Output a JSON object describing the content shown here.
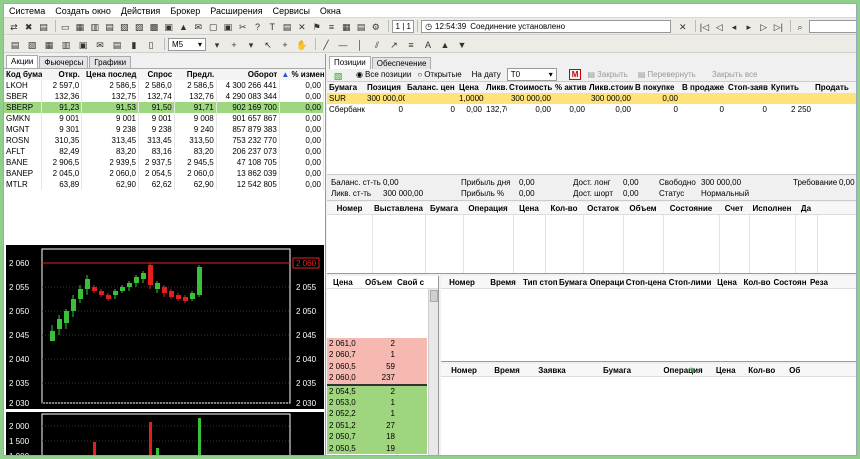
{
  "menu": [
    "Система",
    "Создать окно",
    "Действия",
    "Брокер",
    "Расширения",
    "Сервисы",
    "Окна"
  ],
  "toolbar": {
    "page_counter": "1 | 1",
    "status_time": "12:54:39",
    "status_text": "Соединение установлено",
    "interval": "M5"
  },
  "left_tabs": [
    "Акции",
    "Фьючерсы",
    "Графики"
  ],
  "quotes": {
    "columns": [
      "Код бума",
      "Откр.",
      "Цена послед",
      "Спрос",
      "Предл.",
      "Оборот",
      "% измен."
    ],
    "rows": [
      [
        "LKOH",
        "2 597,0",
        "2 586,5",
        "2 586,0",
        "2 586,5",
        "4 300 266 441",
        "0,00"
      ],
      [
        "SBER",
        "132,36",
        "132,75",
        "132,74",
        "132,76",
        "4 290 083 344",
        "0,00"
      ],
      [
        "SBERP",
        "91,23",
        "91,53",
        "91,50",
        "91,71",
        "902 169 700",
        "0,00"
      ],
      [
        "GMKN",
        "9 001",
        "9 001",
        "9 001",
        "9 008",
        "901 657 867",
        "0,00"
      ],
      [
        "MGNT",
        "9 301",
        "9 238",
        "9 238",
        "9 240",
        "857 879 383",
        "0,00"
      ],
      [
        "ROSN",
        "310,35",
        "313,45",
        "313,45",
        "313,50",
        "753 232 770",
        "0,00"
      ],
      [
        "AFLT",
        "82,49",
        "83,20",
        "83,16",
        "83,20",
        "206 237 073",
        "0,00"
      ],
      [
        "BANE",
        "2 906,5",
        "2 939,5",
        "2 937,5",
        "2 945,5",
        "47 108 705",
        "0,00"
      ],
      [
        "BANEP",
        "2 045,0",
        "2 060,0",
        "2 054,5",
        "2 060,0",
        "13 862 039",
        "0,00"
      ],
      [
        "MTLR",
        "63,89",
        "62,90",
        "62,62",
        "62,90",
        "12 542 805",
        "0,00"
      ]
    ]
  },
  "price_chart": {
    "axis_labels": [
      "2 060",
      "2 055",
      "2 050",
      "2 045",
      "2 040",
      "2 035",
      "2 030"
    ],
    "right_labels": [
      "2 060",
      "2 055",
      "2 050",
      "2 045",
      "2 040",
      "2 035",
      "2 030"
    ],
    "current_label": "2 060"
  },
  "volume_chart": {
    "axis_labels": [
      "2 000",
      "1 500",
      "1 000"
    ]
  },
  "right_tabs": [
    "Позиции",
    "Обеспечение"
  ],
  "positions_toolbar": {
    "all_positions": "Все позиции",
    "open": "Открытые",
    "date_label": "На дату",
    "date_value": "T0",
    "close": "Закрыть",
    "flip": "Перевернуть",
    "close_all": "Закрыть все"
  },
  "positions": {
    "columns": [
      "Бумага",
      "Позиция",
      "Баланс. цен",
      "Цена",
      "Ликв.",
      "Стоимость",
      "% актив",
      "Ликв.стоим",
      "В покупке",
      "В продаже",
      "Стоп-заяв",
      "Купить",
      "Продать"
    ],
    "rows": [
      [
        "SUR",
        "300 000,00",
        "",
        "1,0000000",
        "",
        "300 000,00",
        "",
        "300 000,00",
        "0,00",
        "",
        "",
        "",
        ""
      ],
      [
        "Сбербанк",
        "0",
        "0",
        "0,00",
        "132,76",
        "0,00",
        "0,00",
        "0,00",
        "0",
        "0",
        "0",
        "2 250",
        ""
      ]
    ]
  },
  "summary": {
    "balance_label": "Баланс. ст-ть",
    "balance_value": "0,00",
    "liquid_label": "Ликв. ст-ть",
    "liquid_value": "300 000,00",
    "profit_day_label": "Прибыль дня",
    "profit_day_value": "0,00",
    "profit_pct_label": "Прибыль %",
    "profit_pct_value": "0,00",
    "long_label": "Дост. лонг",
    "long_value": "0,00",
    "short_label": "Дост. шорт",
    "short_value": "0,00",
    "free_label": "Свободно",
    "free_value": "300 000,00",
    "status_label": "Статус",
    "status_value": "Нормальный",
    "req_label": "Требование",
    "req_value": "0,00"
  },
  "orders_columns": [
    "Номер",
    "Выставлена",
    "Бумага",
    "Операция",
    "Цена",
    "Кол-во",
    "Остаток",
    "Объем",
    "Состояние",
    "Счет",
    "Исполнен",
    "Да"
  ],
  "orderbook": {
    "columns": [
      "Цена",
      "Объем",
      "Свой с"
    ],
    "asks": [
      [
        "2 061,0",
        "2"
      ],
      [
        "2 060,7",
        "1"
      ],
      [
        "2 060,5",
        "59"
      ],
      [
        "2 060,0",
        "237"
      ]
    ],
    "bids": [
      [
        "2 054,5",
        "2"
      ],
      [
        "2 053,0",
        "1"
      ],
      [
        "2 052,2",
        "1"
      ],
      [
        "2 051,2",
        "27"
      ],
      [
        "2 050,7",
        "18"
      ],
      [
        "2 050,5",
        "19"
      ]
    ]
  },
  "stop_columns": [
    "Номер",
    "Время",
    "Тип стоп-",
    "Бумага",
    "Операци",
    "Стоп-цена",
    "Стоп-лими",
    "Цена",
    "Кол-во",
    "Состоян",
    "Реза"
  ],
  "trades_columns": [
    "Номер",
    "Время",
    "Заявка",
    "Бумага",
    "Операция",
    "Цена",
    "Кол-во",
    "Об"
  ],
  "colors": {
    "ask": "#f6b9b2",
    "bid": "#9fd57f",
    "selected": "#9ed77f",
    "highlight": "#ffe27a",
    "candle_up": "#3bbf3b",
    "candle_down": "#e02020"
  }
}
